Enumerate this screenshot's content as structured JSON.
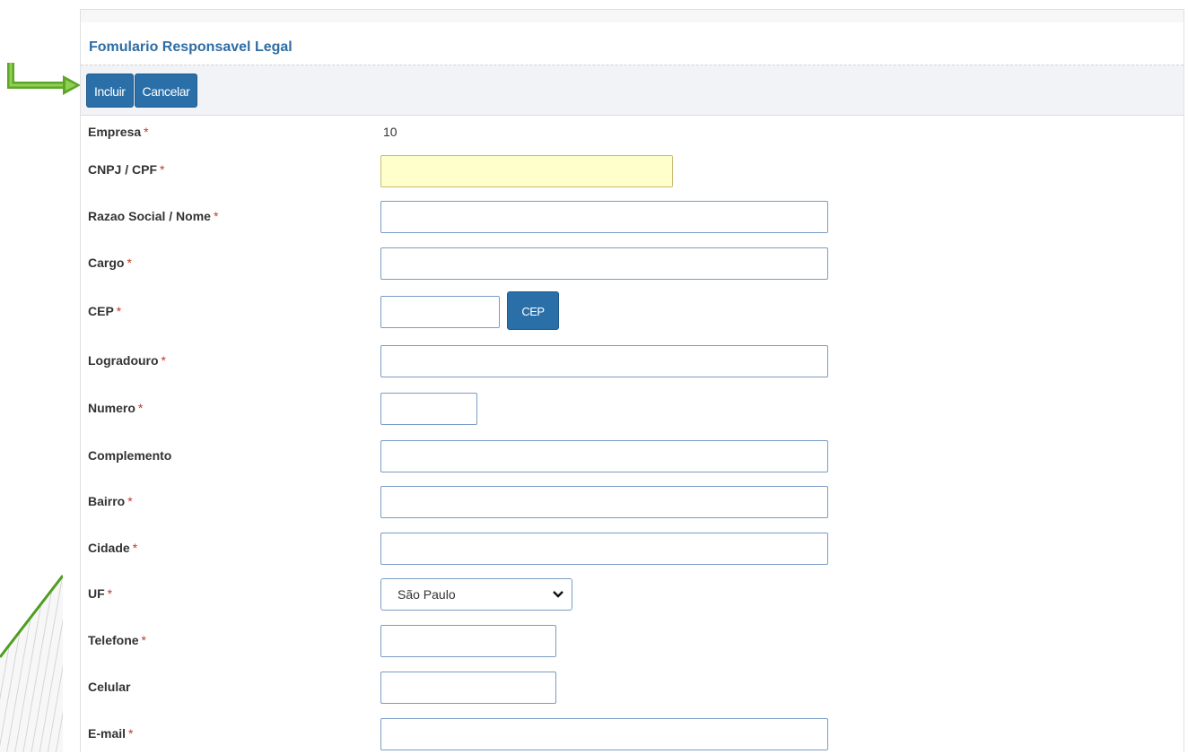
{
  "form": {
    "title": "Fomulario Responsavel Legal"
  },
  "toolbar": {
    "include_label": "Incluir",
    "cancel_label": "Cancelar"
  },
  "fields": {
    "empresa": {
      "label": "Empresa",
      "required": "*",
      "value": "10"
    },
    "cnpj_cpf": {
      "label": "CNPJ / CPF",
      "required": "*",
      "value": ""
    },
    "razao_social": {
      "label": "Razao Social / Nome",
      "required": "*",
      "value": ""
    },
    "cargo": {
      "label": "Cargo",
      "required": "*",
      "value": ""
    },
    "cep": {
      "label": "CEP",
      "required": "*",
      "value": "",
      "button_label": "CEP"
    },
    "logradouro": {
      "label": "Logradouro",
      "required": "*",
      "value": ""
    },
    "numero": {
      "label": "Numero",
      "required": "*",
      "value": ""
    },
    "complemento": {
      "label": "Complemento",
      "value": ""
    },
    "bairro": {
      "label": "Bairro",
      "required": "*",
      "value": ""
    },
    "cidade": {
      "label": "Cidade",
      "required": "*",
      "value": ""
    },
    "uf": {
      "label": "UF",
      "required": "*",
      "selected": "São Paulo"
    },
    "telefone": {
      "label": "Telefone",
      "required": "*",
      "value": ""
    },
    "celular": {
      "label": "Celular",
      "value": ""
    },
    "email": {
      "label": "E-mail",
      "required": "*",
      "value": ""
    }
  },
  "colors": {
    "title": "#2e6da4",
    "button": "#2a6fa8",
    "required_asterisk": "#c0392b",
    "highlight_field": "#ffffcc",
    "annotation_arrow": "#5ea52b"
  },
  "icons": {
    "annotation": "arrow-right-icon",
    "select": "chevron-down-icon"
  }
}
